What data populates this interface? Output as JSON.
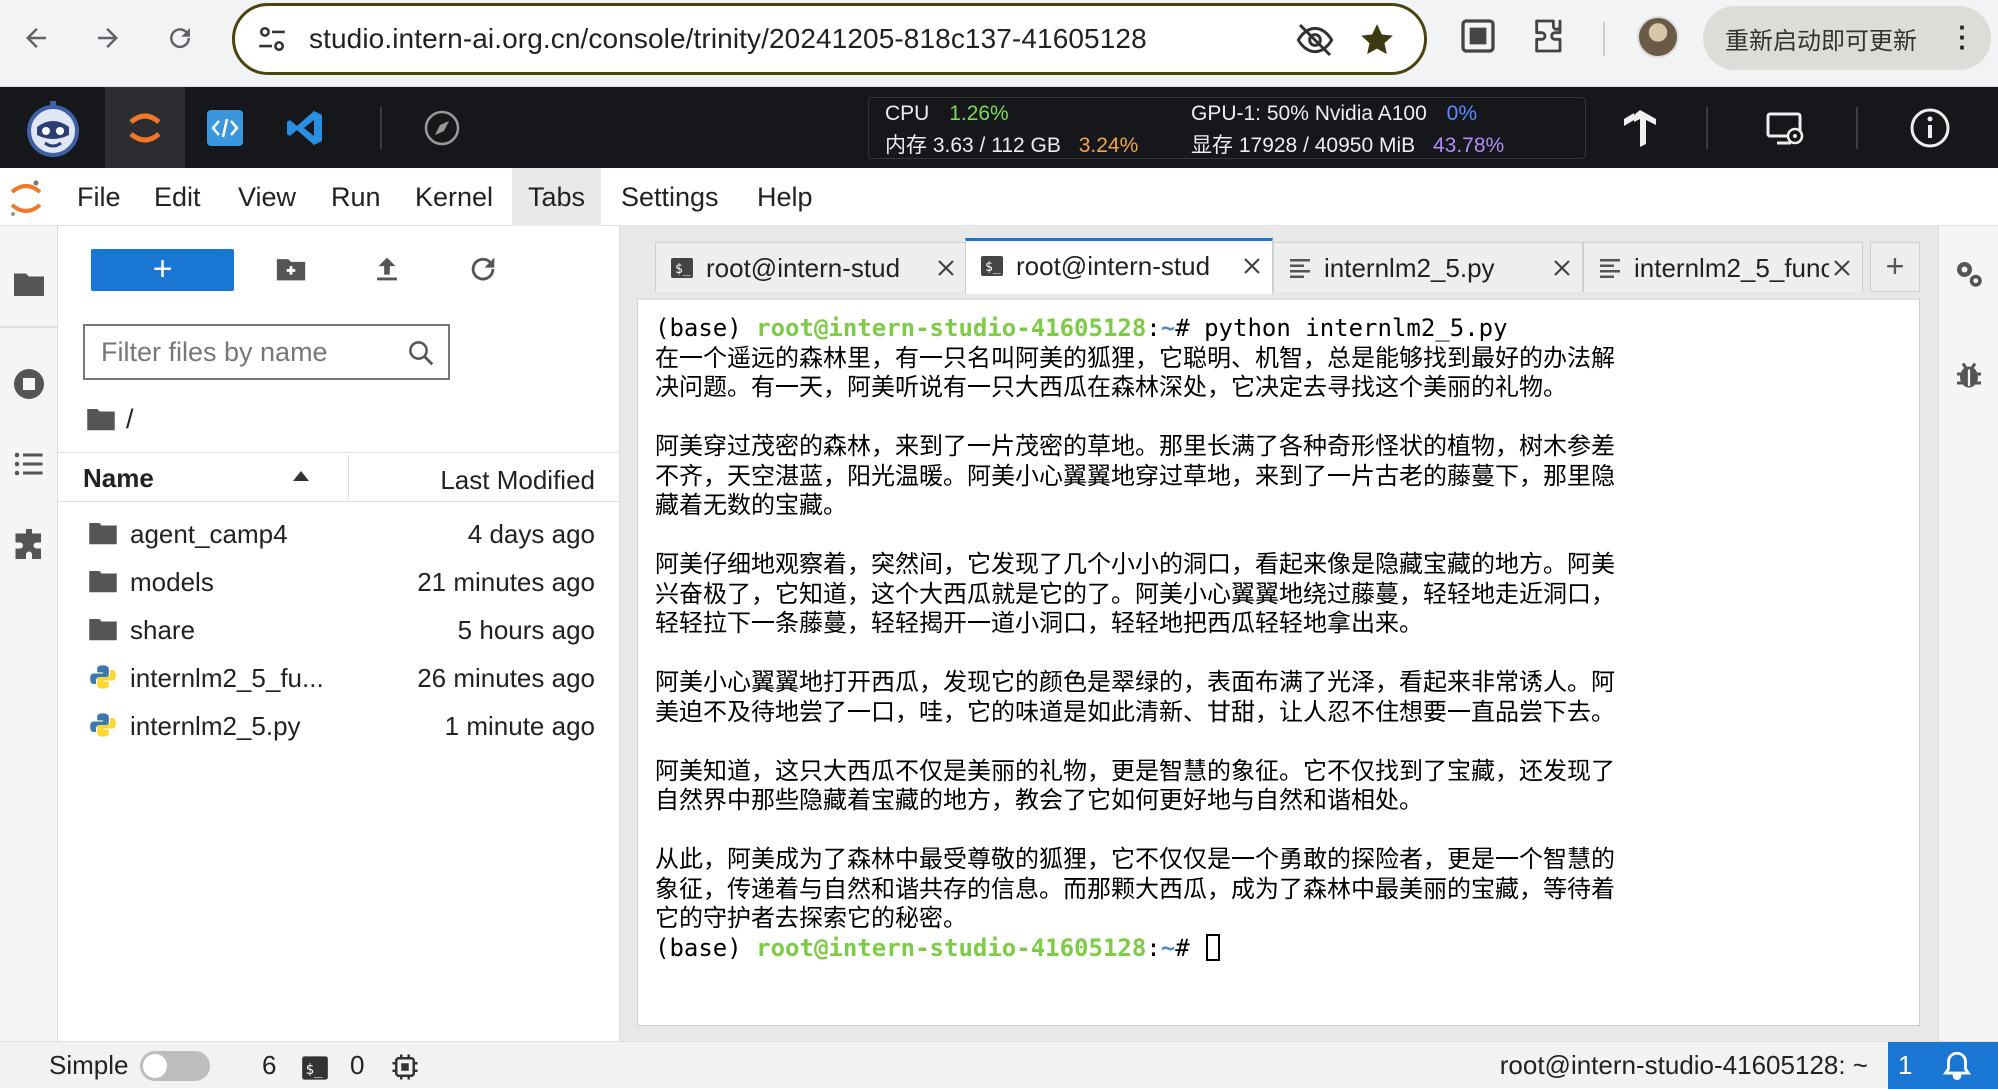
{
  "browser": {
    "url": "studio.intern-ai.org.cn/console/trinity/20241205-818c137-41605128",
    "update_button": "重新启动即可更新"
  },
  "studio_bar": {
    "cpu_label": "CPU",
    "cpu_value": "1.26%",
    "mem_label": "内存 3.63 / 112 GB",
    "mem_value": "3.24%",
    "gpu_label": "GPU-1: 50% Nvidia A100",
    "gpu_value": "0%",
    "vram_label": "显存 17928 / 40950 MiB",
    "vram_value": "43.78%"
  },
  "menubar": {
    "items": [
      "File",
      "Edit",
      "View",
      "Run",
      "Kernel",
      "Tabs",
      "Settings",
      "Help"
    ],
    "active": "Tabs"
  },
  "file_browser": {
    "new_button": "+",
    "filter_placeholder": "Filter files by name",
    "breadcrumb": "/",
    "col_name": "Name",
    "col_modified": "Last Modified",
    "files": [
      {
        "name": "agent_camp4",
        "modified": "4 days ago",
        "type": "folder"
      },
      {
        "name": "models",
        "modified": "21 minutes ago",
        "type": "folder"
      },
      {
        "name": "share",
        "modified": "5 hours ago",
        "type": "folder"
      },
      {
        "name": "internlm2_5_fu...",
        "modified": "26 minutes ago",
        "type": "python"
      },
      {
        "name": "internlm2_5.py",
        "modified": "1 minute ago",
        "type": "python"
      }
    ]
  },
  "tabs": [
    {
      "label": "root@intern-stud",
      "kind": "terminal"
    },
    {
      "label": "root@intern-stud",
      "kind": "terminal"
    },
    {
      "label": "internlm2_5.py",
      "kind": "file"
    },
    {
      "label": "internlm2_5_func",
      "kind": "file"
    }
  ],
  "terminal": {
    "prompt_base": "(base) ",
    "prompt_user": "root@intern-studio-41605128",
    "prompt_sep": ":",
    "prompt_path": "~",
    "prompt_end": "# ",
    "command": "python internlm2_5.py",
    "output": [
      "在一个遥远的森林里，有一只名叫阿美的狐狸，它聪明、机智，总是能够找到最好的办法解",
      "决问题。有一天，阿美听说有一只大西瓜在森林深处，它决定去寻找这个美丽的礼物。",
      "",
      "阿美穿过茂密的森林，来到了一片茂密的草地。那里长满了各种奇形怪状的植物，树木参差",
      "不齐，天空湛蓝，阳光温暖。阿美小心翼翼地穿过草地，来到了一片古老的藤蔓下，那里隐",
      "藏着无数的宝藏。",
      "",
      "阿美仔细地观察着，突然间，它发现了几个小小的洞口，看起来像是隐藏宝藏的地方。阿美",
      "兴奋极了，它知道，这个大西瓜就是它的了。阿美小心翼翼地绕过藤蔓，轻轻地走近洞口，",
      "轻轻拉下一条藤蔓，轻轻揭开一道小洞口，轻轻地把西瓜轻轻地拿出来。",
      "",
      "阿美小心翼翼地打开西瓜，发现它的颜色是翠绿的，表面布满了光泽，看起来非常诱人。阿",
      "美迫不及待地尝了一口，哇，它的味道是如此清新、甘甜，让人忍不住想要一直品尝下去。",
      "",
      "阿美知道，这只大西瓜不仅是美丽的礼物，更是智慧的象征。它不仅找到了宝藏，还发现了",
      "自然界中那些隐藏着宝藏的地方，教会了它如何更好地与自然和谐相处。",
      "",
      "从此，阿美成为了森林中最受尊敬的狐狸，它不仅仅是一个勇敢的探险者，更是一个智慧的",
      "象征，传递着与自然和谐共存的信息。而那颗大西瓜，成为了森林中最美丽的宝藏，等待着",
      "它的守护者去探索它的秘密。"
    ]
  },
  "statusbar": {
    "mode_label": "Simple",
    "kernels_count": "6",
    "terminals_count": "0",
    "terminal_name": "root@intern-studio-41605128: ~",
    "notifications": "1"
  },
  "colors": {
    "accent": "#1976d2",
    "prompt_green": "#7ecb47",
    "prompt_blue": "#5b88c8",
    "studio_bar_bg": "#15171a"
  }
}
